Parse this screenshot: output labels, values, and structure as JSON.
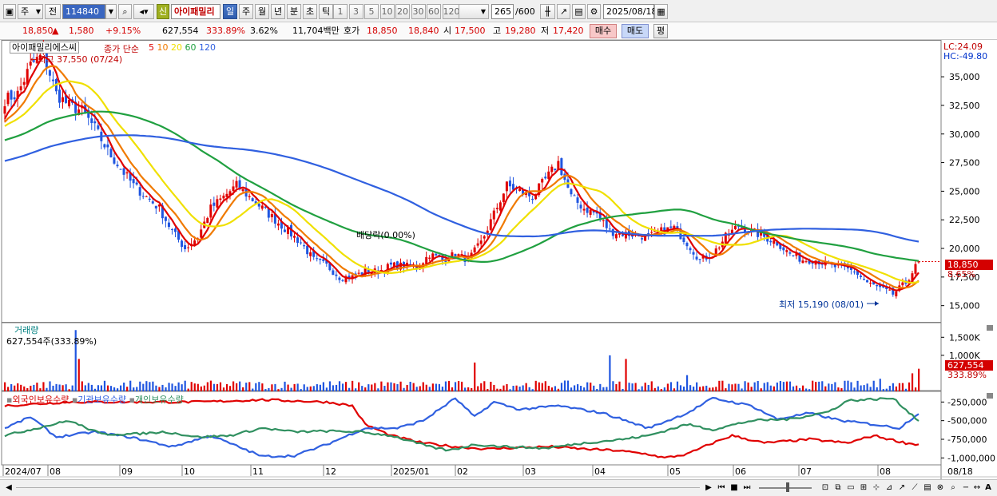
{
  "toolbar": {
    "type_select": "주",
    "prefix": "전",
    "code": "114840",
    "new_badge": "신",
    "stock_name": "아이패밀리",
    "periods": [
      "일",
      "주",
      "월",
      "년",
      "분",
      "초",
      "틱"
    ],
    "active_period": "일",
    "intervals": [
      "1",
      "3",
      "5",
      "10",
      "20",
      "30",
      "60",
      "120"
    ],
    "count": "265",
    "count_total": "/600",
    "date": "2025/08/18"
  },
  "quote": {
    "price": "18,850",
    "arrow": "▲",
    "change": "1,580",
    "change_pct": "+9.15%",
    "volume": "627,554",
    "volume_ratio": "333.89%",
    "turnover": "3.62%",
    "amount": "11,704백만",
    "ask_label": "호가",
    "ask": "18,850",
    "bid": "18,840",
    "open_label": "시",
    "open": "17,500",
    "high_label": "고",
    "high": "19,280",
    "low_label": "저",
    "low": "17,420",
    "buy_label": "매수",
    "sell_label": "매도",
    "eval_label": "평"
  },
  "price_panel": {
    "title": "아이패밀리에스씨",
    "ma_label": "종가 단순",
    "ma_periods": [
      "5",
      "10",
      "20",
      "60",
      "120"
    ],
    "high_note": "←최고 37,550 (07/24)",
    "low_note": "최저 15,190 (08/01)",
    "dividend_note": "배당락(0.00%)",
    "lc": "LC:24.09",
    "hc": "HC:-49.80",
    "current_tag": "18,850",
    "pct_tag": "8.65%",
    "ticks": [
      {
        "label": "35,000",
        "v": 35000
      },
      {
        "label": "32,500",
        "v": 32500
      },
      {
        "label": "30,000",
        "v": 30000
      },
      {
        "label": "27,500",
        "v": 27500
      },
      {
        "label": "25,000",
        "v": 25000
      },
      {
        "label": "22,500",
        "v": 22500
      },
      {
        "label": "20,000",
        "v": 20000
      },
      {
        "label": "17,500",
        "v": 17500
      },
      {
        "label": "15,000",
        "v": 15000
      }
    ]
  },
  "volume_panel": {
    "title": "거래량",
    "info": "627,554주(333.89%)",
    "ticks": [
      {
        "label": "1,500K",
        "v": 1500
      },
      {
        "label": "1,000K",
        "v": 1000
      }
    ],
    "current_tag": "627,554",
    "pct_tag": "333.89%"
  },
  "holdings_panel": {
    "series": [
      "외국인보유수량",
      "기관보유수량",
      "개인보유수량"
    ],
    "ticks": [
      {
        "label": "-250,000",
        "v": -250000
      },
      {
        "label": "-500,000",
        "v": -500000
      },
      {
        "label": "-750,000",
        "v": -750000
      },
      {
        "label": "-1,000,000",
        "v": -1000000
      }
    ]
  },
  "date_axis": {
    "labels": [
      "2024/07",
      "08",
      "09",
      "10",
      "11",
      "12",
      "2025/01",
      "02",
      "03",
      "04",
      "05",
      "06",
      "07",
      "08",
      "08/18"
    ]
  },
  "colors": {
    "up": "#e00000",
    "down": "#1f55e0",
    "ma5": "#e00000",
    "ma10": "#f07a00",
    "ma20": "#f0e000",
    "ma60": "#20a040",
    "ma120": "#3060e0",
    "foreign": "#e00000",
    "institution": "#3060e0",
    "individual": "#309060"
  },
  "chart_data": [
    {
      "type": "candlestick",
      "title": "아이패밀리에스씨",
      "series": [
        {
          "name": "종가",
          "points": [
            [
              0,
              33000
            ],
            [
              4,
              33500
            ],
            [
              8,
              36000
            ],
            [
              12,
              37000
            ],
            [
              16,
              33500
            ],
            [
              20,
              32500
            ],
            [
              24,
              32000
            ],
            [
              28,
              30500
            ],
            [
              32,
              28500
            ],
            [
              36,
              27000
            ],
            [
              40,
              25500
            ],
            [
              44,
              24500
            ],
            [
              48,
              23500
            ],
            [
              52,
              21500
            ],
            [
              56,
              20000
            ],
            [
              60,
              21000
            ],
            [
              64,
              23500
            ],
            [
              68,
              24500
            ],
            [
              72,
              25500
            ],
            [
              76,
              24500
            ],
            [
              80,
              23500
            ],
            [
              84,
              22500
            ],
            [
              88,
              21500
            ],
            [
              92,
              20500
            ],
            [
              96,
              19000
            ],
            [
              100,
              18500
            ],
            [
              104,
              17500
            ],
            [
              108,
              17500
            ],
            [
              112,
              18000
            ],
            [
              116,
              18000
            ],
            [
              120,
              18500
            ],
            [
              124,
              18500
            ],
            [
              128,
              18300
            ],
            [
              132,
              19500
            ],
            [
              136,
              19000
            ],
            [
              140,
              19500
            ],
            [
              144,
              19000
            ],
            [
              148,
              20500
            ],
            [
              152,
              23000
            ],
            [
              156,
              25500
            ],
            [
              160,
              25000
            ],
            [
              164,
              24500
            ],
            [
              168,
              26000
            ],
            [
              172,
              27500
            ],
            [
              176,
              24500
            ],
            [
              180,
              23500
            ],
            [
              184,
              23000
            ],
            [
              188,
              21500
            ],
            [
              192,
              21300
            ],
            [
              196,
              21200
            ],
            [
              200,
              21000
            ],
            [
              204,
              21500
            ],
            [
              208,
              21800
            ],
            [
              212,
              20500
            ],
            [
              216,
              19000
            ],
            [
              220,
              19500
            ],
            [
              224,
              21000
            ],
            [
              228,
              22000
            ],
            [
              232,
              21500
            ],
            [
              236,
              21000
            ],
            [
              240,
              20500
            ],
            [
              244,
              19500
            ],
            [
              248,
              19000
            ],
            [
              252,
              19000
            ],
            [
              256,
              18500
            ],
            [
              260,
              18300
            ],
            [
              264,
              18000
            ],
            [
              268,
              17000
            ],
            [
              272,
              16500
            ],
            [
              276,
              16000
            ],
            [
              280,
              17000
            ],
            [
              284,
              18850
            ]
          ]
        },
        {
          "name": "5",
          "values": "MA"
        },
        {
          "name": "10",
          "values": "MA"
        },
        {
          "name": "20",
          "values": "MA"
        },
        {
          "name": "60",
          "values": "MA"
        },
        {
          "name": "120",
          "values": "MA"
        }
      ],
      "x_range": [
        "2024/07",
        "2025/08/18"
      ],
      "y_range": [
        14000,
        37800
      ]
    },
    {
      "type": "bar",
      "title": "거래량",
      "unit": "K",
      "spikes": [
        [
          22,
          1700
        ],
        [
          23,
          900
        ],
        [
          146,
          800
        ],
        [
          188,
          1000
        ],
        [
          193,
          900
        ],
        [
          212,
          450
        ],
        [
          272,
          350
        ],
        [
          282,
          500
        ],
        [
          284,
          627.554
        ]
      ],
      "baseline": [
        60,
        300
      ]
    },
    {
      "type": "line",
      "series": [
        {
          "name": "외국인보유수량",
          "points": [
            [
              0,
              -300000
            ],
            [
              20,
              -250000
            ],
            [
              40,
              -250000
            ],
            [
              60,
              -250000
            ],
            [
              80,
              -220000
            ],
            [
              100,
              -250000
            ],
            [
              108,
              -300000
            ],
            [
              112,
              -550000
            ],
            [
              120,
              -700000
            ],
            [
              130,
              -800000
            ],
            [
              140,
              -850000
            ],
            [
              150,
              -880000
            ],
            [
              160,
              -860000
            ],
            [
              170,
              -850000
            ],
            [
              180,
              -880000
            ],
            [
              190,
              -900000
            ],
            [
              200,
              -950000
            ],
            [
              205,
              -1000000
            ],
            [
              212,
              -950000
            ],
            [
              220,
              -800000
            ],
            [
              226,
              -700000
            ],
            [
              236,
              -800000
            ],
            [
              250,
              -750000
            ],
            [
              262,
              -800000
            ],
            [
              270,
              -700000
            ],
            [
              280,
              -800000
            ],
            [
              284,
              -820000
            ]
          ]
        },
        {
          "name": "기관보유수량",
          "points": [
            [
              0,
              -600000
            ],
            [
              8,
              -450000
            ],
            [
              16,
              -720000
            ],
            [
              28,
              -650000
            ],
            [
              40,
              -730000
            ],
            [
              52,
              -850000
            ],
            [
              64,
              -700000
            ],
            [
              80,
              -980000
            ],
            [
              90,
              -970000
            ],
            [
              100,
              -820000
            ],
            [
              112,
              -600000
            ],
            [
              122,
              -600000
            ],
            [
              130,
              -500000
            ],
            [
              140,
              -200000
            ],
            [
              146,
              -450000
            ],
            [
              152,
              -250000
            ],
            [
              160,
              -350000
            ],
            [
              172,
              -300000
            ],
            [
              186,
              -400000
            ],
            [
              200,
              -600000
            ],
            [
              212,
              -400000
            ],
            [
              220,
              -200000
            ],
            [
              232,
              -300000
            ],
            [
              240,
              -480000
            ],
            [
              250,
              -400000
            ],
            [
              260,
              -500000
            ],
            [
              270,
              -550000
            ],
            [
              278,
              -600000
            ],
            [
              284,
              -400000
            ]
          ]
        },
        {
          "name": "개인보유수량",
          "points": [
            [
              0,
              -700000
            ],
            [
              10,
              -600000
            ],
            [
              20,
              -500000
            ],
            [
              30,
              -680000
            ],
            [
              40,
              -680000
            ],
            [
              50,
              -650000
            ],
            [
              60,
              -720000
            ],
            [
              70,
              -700000
            ],
            [
              80,
              -600000
            ],
            [
              90,
              -650000
            ],
            [
              100,
              -640000
            ],
            [
              110,
              -650000
            ],
            [
              120,
              -700000
            ],
            [
              132,
              -850000
            ],
            [
              138,
              -900000
            ],
            [
              146,
              -820000
            ],
            [
              156,
              -850000
            ],
            [
              168,
              -870000
            ],
            [
              180,
              -800000
            ],
            [
              192,
              -750000
            ],
            [
              200,
              -700000
            ],
            [
              212,
              -550000
            ],
            [
              220,
              -620000
            ],
            [
              232,
              -500000
            ],
            [
              244,
              -480000
            ],
            [
              256,
              -380000
            ],
            [
              262,
              -230000
            ],
            [
              276,
              -200000
            ],
            [
              284,
              -500000
            ]
          ]
        }
      ],
      "y_range": [
        -1050000,
        -150000
      ]
    }
  ]
}
